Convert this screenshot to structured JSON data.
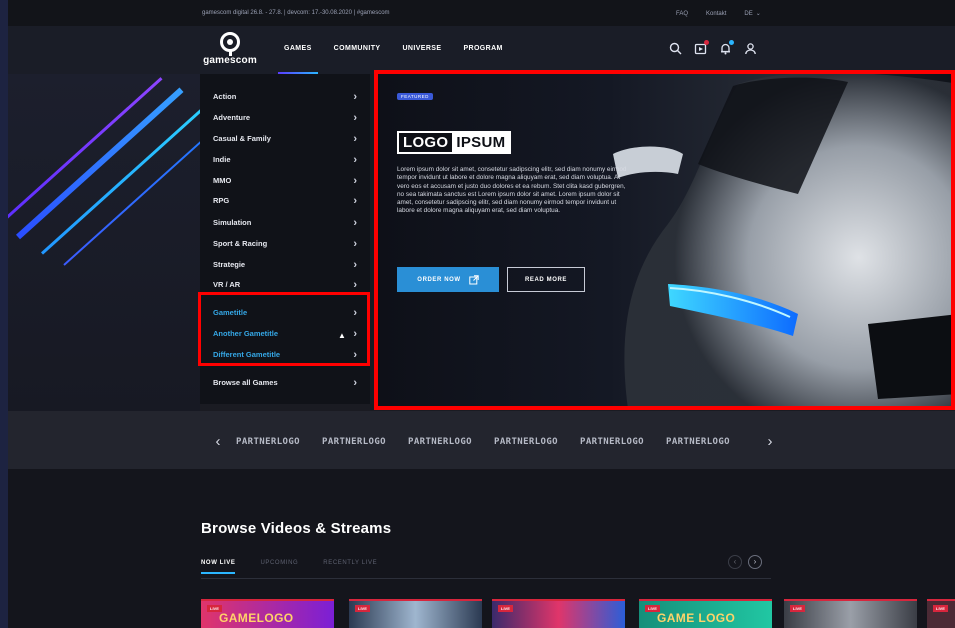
{
  "topbar": {
    "info": "gamescom digital 26.8. - 27.8.  |  devcom: 17.-30.08.2020  |  #gamescom",
    "faq": "FAQ",
    "contact": "Kontakt",
    "lang": "DE"
  },
  "header": {
    "logo_text": "gamescom",
    "nav": [
      "GAMES",
      "COMMUNITY",
      "UNIVERSE",
      "PROGRAM"
    ],
    "icons": [
      "search-icon",
      "video-icon",
      "bell-icon",
      "user-icon"
    ]
  },
  "dropdown": {
    "items": [
      "Action",
      "Adventure",
      "Casual & Family",
      "Indie",
      "MMO",
      "RPG",
      "Simulation",
      "Sport & Racing",
      "Strategie",
      "VR / AR"
    ],
    "games": [
      "Gametitle",
      "Another Gametitle",
      "Different Gametitle"
    ],
    "browse_all": "Browse all Games"
  },
  "hero": {
    "badge": "FEATURED",
    "brand_left": "LOGO",
    "brand_right": "IPSUM",
    "body": "Lorem ipsum dolor sit amet, consetetur sadipscing elitr, sed diam nonumy eirmod tempor invidunt ut labore et dolore magna aliquyam erat, sed diam voluptua. At vero eos et accusam et justo duo dolores et ea rebum. Stet clita kasd gubergren, no sea takimata sanctus est Lorem ipsum dolor sit amet. Lorem ipsum dolor sit amet, consetetur sadipscing elitr, sed diam nonumy eirmod tempor invidunt ut labore et dolore magna aliquyam erat, sed diam voluptua.",
    "order_label": "ORDER NOW",
    "read_label": "READ MORE"
  },
  "partners": {
    "prev": "‹",
    "next": "›",
    "logos": [
      "PARTNERLOGO",
      "PARTNERLOGO",
      "PARTNERLOGO",
      "PARTNERLOGO",
      "PARTNERLOGO",
      "PARTNERLOGO"
    ]
  },
  "videos": {
    "title": "Browse Videos & Streams",
    "tabs": [
      "NOW LIVE",
      "UPCOMING",
      "RECENTLY LIVE"
    ],
    "thumbs": [
      {
        "badge": "LIVE",
        "caption": "GAMELOGO"
      },
      {
        "badge": "LIVE",
        "caption": ""
      },
      {
        "badge": "LIVE",
        "caption": ""
      },
      {
        "badge": "LIVE",
        "caption": "GAME LOGO"
      },
      {
        "badge": "LIVE",
        "caption": ""
      },
      {
        "badge": "LIVE",
        "caption": ""
      }
    ]
  },
  "colors": {
    "accent_blue": "#2a8fd6",
    "highlight_red": "#ff0000",
    "live_red": "#d7263d",
    "game_link": "#35a7e6"
  }
}
